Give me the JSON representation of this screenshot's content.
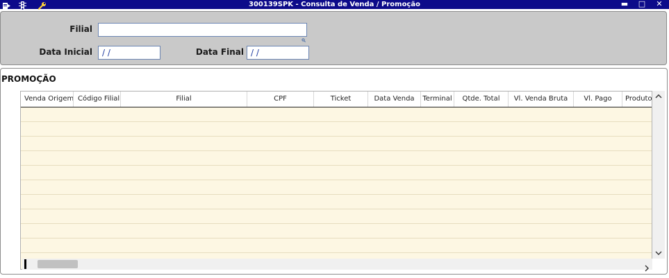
{
  "window": {
    "title": "300139SPK - Consulta de Venda / Promoção",
    "minimize_glyph": "▬",
    "maximize_glyph": "□",
    "close_glyph": "✕",
    "icons": [
      "export-icon",
      "traffic-light-icon",
      "wrench-icon"
    ]
  },
  "filters": {
    "filial_label": "Filial",
    "filial_value": "",
    "data_inicial_label": "Data Inicial",
    "data_inicial_value": "/ /",
    "data_final_label": "Data Final",
    "data_final_value": "/ /"
  },
  "section": {
    "title": "PROMOÇÃO"
  },
  "grid": {
    "columns": [
      "Venda Origem",
      "Código Filial",
      "Filial",
      "CPF",
      "Ticket",
      "Data Venda",
      "Terminal",
      "Qtde. Total",
      "Vl. Venda Bruta",
      "Vl. Pago",
      "Produto"
    ],
    "rows": []
  },
  "colors": {
    "titlebar": "#0d0b8a",
    "panel": "#c9c9c9",
    "grid_bg": "#fdf7e3",
    "field_text": "#1f3ca0"
  }
}
